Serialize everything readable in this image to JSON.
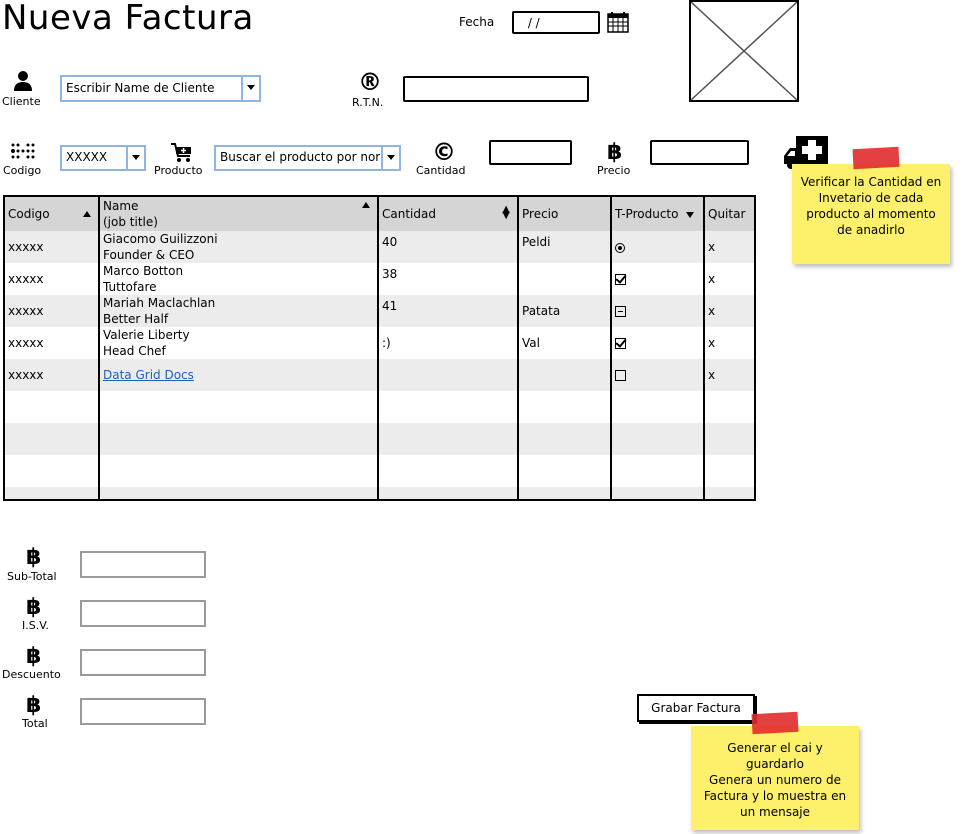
{
  "header": {
    "title": "Nueva Factura",
    "fecha_label": "Fecha",
    "fecha_value": " / /"
  },
  "cliente": {
    "label": "Cliente",
    "combo_value": "Escribir Name de Cliente",
    "rtn_icon": "®",
    "rtn_label": "R.T.N.",
    "rtn_value": ""
  },
  "producto_row": {
    "codigo_label": "Codigo",
    "codigo_value": "XXXXX",
    "producto_label": "Producto",
    "producto_value": "Buscar el producto por nom",
    "cantidad_icon": "©",
    "cantidad_label": "Cantidad",
    "cantidad_value": "",
    "precio_icon": "฿",
    "precio_label": "Precio",
    "precio_value": ""
  },
  "notes": {
    "inventario": "Verificar la Cantidad en Invetario de cada producto al momento de anadirlo",
    "grabar": "Generar el cai y guardarlo\nGenera un numero de Factura y lo muestra en un mensaje"
  },
  "grid": {
    "columns": [
      "Codigo",
      "Name\n(job title)",
      "Cantidad",
      "Precio",
      "T-Producto",
      "Quitar"
    ],
    "rows": [
      {
        "codigo": "xxxxx",
        "name": "Giacomo Guilizzoni",
        "title": "Founder & CEO",
        "cantidad": "40",
        "precio": "Peldi",
        "tproducto": "radio",
        "quitar": "x"
      },
      {
        "codigo": "xxxxx",
        "name": "Marco Botton",
        "title": "Tuttofare",
        "cantidad": "38",
        "precio": "",
        "tproducto": "checked",
        "quitar": "x"
      },
      {
        "codigo": "xxxxx",
        "name": "Mariah Maclachlan",
        "title": "Better Half",
        "cantidad": "41",
        "precio": "Patata",
        "tproducto": "indeterminate",
        "quitar": "x"
      },
      {
        "codigo": "xxxxx",
        "name": "Valerie Liberty",
        "title": "Head Chef",
        "cantidad": ":)",
        "precio": "Val",
        "tproducto": "checked",
        "quitar": "x"
      },
      {
        "codigo": "xxxxx",
        "name": "Data Grid Docs",
        "title": "",
        "cantidad": "",
        "precio": "",
        "tproducto": "unchecked",
        "quitar": "x",
        "link": true
      }
    ]
  },
  "totals": {
    "icon": "฿",
    "subtotal_label": "Sub-Total",
    "isv_label": "I.S.V.",
    "descuento_label": "Descuento",
    "total_label": "Total"
  },
  "actions": {
    "grabar_label": "Grabar Factura"
  },
  "colors": {
    "note": "#fdf06b",
    "tape": "#e02c2c",
    "combo_border": "#8fb4e6",
    "grid_header": "#d5d5d5",
    "link": "#1f5fbf"
  }
}
